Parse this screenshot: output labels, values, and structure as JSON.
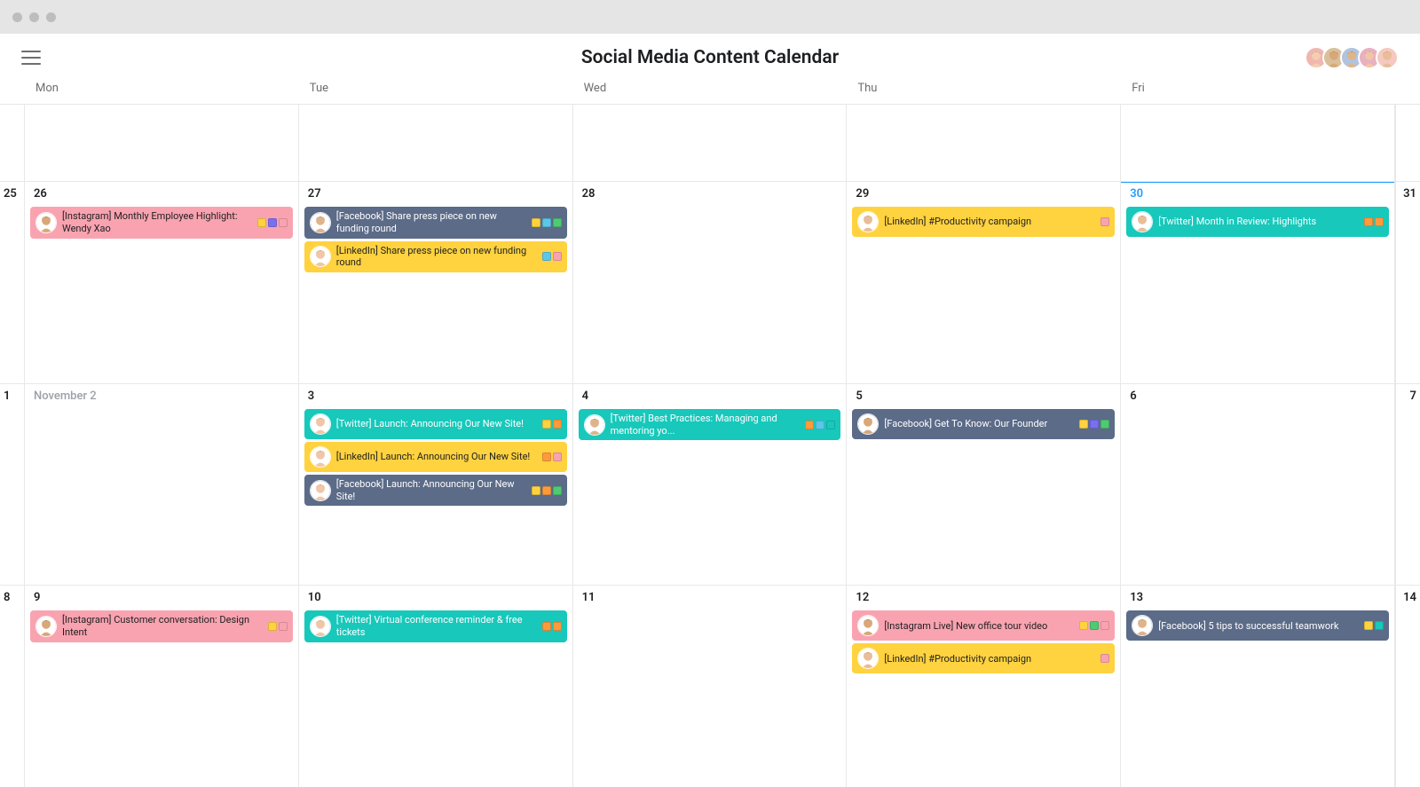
{
  "chrome": {
    "dots": 3
  },
  "header": {
    "title": "Social Media Content Calendar",
    "avatars": [
      {
        "bg": "#f1b6b0",
        "face": "f2"
      },
      {
        "bg": "#d9c09a",
        "face": "m1"
      },
      {
        "bg": "#b0c4de",
        "face": "m2"
      },
      {
        "bg": "#e8b0c0",
        "face": "f1"
      },
      {
        "bg": "#f6c9c0",
        "face": "m3"
      }
    ]
  },
  "weekdays": [
    "Mon",
    "Tue",
    "Wed",
    "Thu",
    "Fri"
  ],
  "colors": {
    "pink": "#f9a3b0",
    "yellow": "#ffd23f",
    "slate": "#5b6b88",
    "teal": "#17c8bb"
  },
  "avatars_palette": {
    "f1": {
      "skin": "#f1c6a7",
      "hair": "#6b3b1f"
    },
    "f2": {
      "skin": "#f3ceb1",
      "hair": "#3a2a1a"
    },
    "m1": {
      "skin": "#d9a878",
      "hair": "#2b1e12"
    },
    "m2": {
      "skin": "#e0b48a",
      "hair": "#3b2d1e"
    },
    "m3": {
      "skin": "#e9bd99",
      "hair": "#5a3a20"
    }
  },
  "weeks": [
    {
      "partial_top": true,
      "left_edge": "",
      "right_edge": "",
      "days": [
        {
          "label": "",
          "cards": []
        },
        {
          "label": "",
          "cards": []
        },
        {
          "label": "",
          "cards": []
        },
        {
          "label": "",
          "cards": []
        },
        {
          "label": "",
          "cards": []
        }
      ]
    },
    {
      "left_edge": "25",
      "right_edge": "31",
      "shadow": true,
      "days": [
        {
          "label": "26",
          "cards": [
            {
              "color": "pink",
              "avatar": "m1",
              "text": "[Instagram] Monthly Employ­ee Highlight: Wendy Xao",
              "tags": [
                "yellow",
                "purple",
                "pink"
              ]
            }
          ]
        },
        {
          "label": "27",
          "cards": [
            {
              "color": "slate",
              "avatar": "m2",
              "text": "[Facebook] Share press piece on new funding round",
              "tags": [
                "yellow",
                "blue",
                "green"
              ]
            },
            {
              "color": "yellow",
              "avatar": "f1",
              "text": "[LinkedIn] Share press piece on new funding round",
              "tags": [
                "blue",
                "pink"
              ]
            }
          ]
        },
        {
          "label": "28",
          "cards": []
        },
        {
          "label": "29",
          "cards": [
            {
              "color": "yellow",
              "avatar": "m3",
              "text": "[LinkedIn] #Productivity campaign",
              "tags": [
                "pink"
              ]
            }
          ]
        },
        {
          "label": "30",
          "today": true,
          "cards": [
            {
              "color": "teal",
              "avatar": "m3",
              "text": "[Twitter] Month in Review: Highlights",
              "tags": [
                "orange",
                "orange"
              ]
            }
          ]
        }
      ]
    },
    {
      "left_edge": "1",
      "right_edge": "7",
      "days": [
        {
          "label": "November 2",
          "muted": true,
          "cards": []
        },
        {
          "label": "3",
          "cards": [
            {
              "color": "teal",
              "avatar": "f1",
              "text": "[Twitter] Launch: Announcing Our New Site!",
              "tags": [
                "yellow",
                "orange"
              ]
            },
            {
              "color": "yellow",
              "avatar": "f1",
              "text": "[LinkedIn] Launch: Announcing Our New Site!",
              "tags": [
                "orange",
                "pink"
              ]
            },
            {
              "color": "slate",
              "avatar": "f1",
              "text": "[Facebook] Launch: An­nouncing Our New Site!",
              "tags": [
                "yellow",
                "orange",
                "green"
              ]
            }
          ]
        },
        {
          "label": "4",
          "cards": [
            {
              "color": "teal",
              "avatar": "m2",
              "text": "[Twitter] Best Practices: Managing and mentoring yo...",
              "tags": [
                "orange",
                "blue",
                "teal"
              ]
            }
          ]
        },
        {
          "label": "5",
          "cards": [
            {
              "color": "slate",
              "avatar": "m1",
              "text": "[Facebook] Get To Know: Our Founder",
              "tags": [
                "yellow",
                "purple",
                "green"
              ]
            }
          ]
        },
        {
          "label": "6",
          "cards": []
        }
      ]
    },
    {
      "left_edge": "8",
      "right_edge": "14",
      "days": [
        {
          "label": "9",
          "cards": [
            {
              "color": "pink",
              "avatar": "m1",
              "text": "[Instagram] Customer conver­sation: Design Intent",
              "tags": [
                "yellow",
                "pink"
              ]
            }
          ]
        },
        {
          "label": "10",
          "cards": [
            {
              "color": "teal",
              "avatar": "f1",
              "text": "[Twitter] Virtual conference re­minder & free tickets",
              "tags": [
                "orange",
                "orange"
              ]
            }
          ]
        },
        {
          "label": "11",
          "cards": []
        },
        {
          "label": "12",
          "cards": [
            {
              "color": "pink",
              "avatar": "m1",
              "text": "[Instagram Live] New office tour video",
              "tags": [
                "yellow",
                "green",
                "pink"
              ]
            },
            {
              "color": "yellow",
              "avatar": "m3",
              "text": "[LinkedIn] #Productivity campaign",
              "tags": [
                "pink"
              ]
            }
          ]
        },
        {
          "label": "13",
          "cards": [
            {
              "color": "slate",
              "avatar": "m2",
              "text": "[Facebook] 5 tips to successful teamwork",
              "tags": [
                "yellow",
                "teal"
              ]
            }
          ]
        }
      ]
    }
  ]
}
